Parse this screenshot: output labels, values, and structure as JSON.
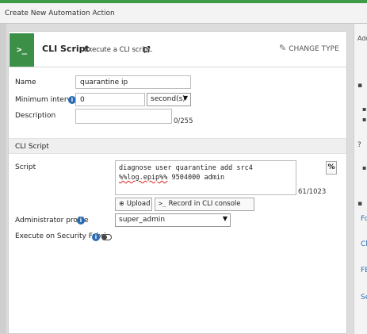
{
  "dialog": {
    "title": "Create New Automation Action"
  },
  "card": {
    "icon": ">_",
    "title": "CLI Script",
    "subtitle": "Execute a CLI script.",
    "change_type_label": "CHANGE TYPE"
  },
  "form": {
    "name_label": "Name",
    "name_value": "quarantine ip",
    "min_interval_label": "Minimum interval",
    "min_interval_value": "0",
    "interval_unit": "second(s)",
    "description_label": "Description",
    "description_value": "",
    "description_counter": "0/255"
  },
  "cli_section": {
    "title": "CLI Script",
    "script_label": "Script",
    "script_before": "diagnose user quarantine add src4 ",
    "script_flagged": "%%log.epip%%",
    "script_after": " 9504000 admin",
    "script_counter": "61/1023",
    "percent_button": "%",
    "upload_label": "Upload",
    "record_label": "Record in CLI console",
    "admin_profile_label": "Administrator profile",
    "admin_profile_value": "super_admin",
    "security_fabric_label": "Execute on Security Fabric"
  },
  "right_panel": {
    "top_fragment": "Add",
    "links": [
      "Fo",
      "Cl",
      "FE",
      "Se"
    ]
  },
  "colors": {
    "accent_green": "#3c8f47",
    "info_blue": "#2b6cb3"
  }
}
